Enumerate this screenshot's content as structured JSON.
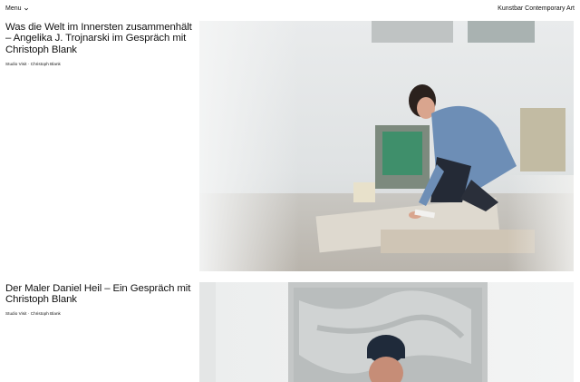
{
  "header": {
    "menu_label": "Menu",
    "brand": "Kunstbar Contemporary Art"
  },
  "articles": [
    {
      "title": "Was die Welt im Innersten zusammenhält – Angelika J. Trojnarski im Gespräch mit Christoph Blank",
      "meta": "Studio Visit · Christoph Blank"
    },
    {
      "title": "Der Maler Daniel Heil – Ein Gespräch mit Christoph Blank",
      "meta": "Studio Visit · Christoph Blank"
    }
  ]
}
